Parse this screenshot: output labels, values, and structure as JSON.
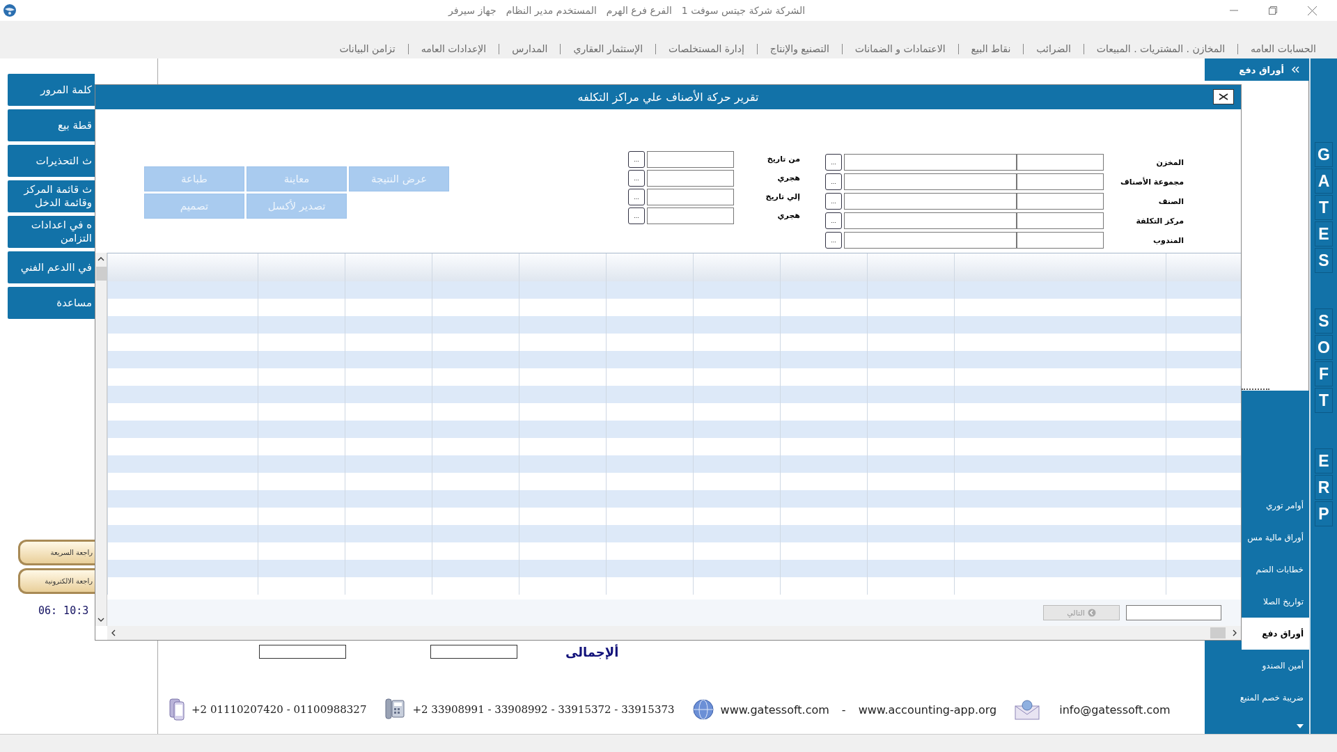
{
  "title_bar": {
    "segments": [
      "الشركة شركة جيتس سوفت 1",
      "الفرع فرع الهرم",
      "المستخدم مدير النظام",
      "جهاز سيرفر"
    ]
  },
  "menu": [
    "الحسابات العامه",
    "المخازن . المشتريات . المبيعات",
    "الضرائب",
    "نقاط البيع",
    "الاعتمادات و الضمانات",
    "التصنيع والإنتاج",
    "إدارة المستخلصات",
    "الإستثمار العقاري",
    "المدارس",
    "الإعدادات العامه",
    "تزامن البيانات"
  ],
  "left_sidebar": {
    "buttons": [
      "كلمة المرور",
      "قطة بيع",
      "ث التحذيرات",
      "ث قائمة المركز وقائمة الدخل",
      "ه في اعدادات التزامن",
      "في االدعم الفني",
      "مساعدة"
    ],
    "quick_buttons": [
      "راجعة السريعة",
      "راجعة الالكترونية"
    ],
    "clock": "06: 10:3"
  },
  "right_panel": {
    "header": "أوراق دفع",
    "items": [
      {
        "label": "أوامر توري",
        "selected": false
      },
      {
        "label": "أوراق مالية مس",
        "selected": false
      },
      {
        "label": "خطابات الضم",
        "selected": false
      },
      {
        "label": "تواريخ الصلا",
        "selected": false
      },
      {
        "label": "أوراق دفع",
        "selected": true
      },
      {
        "label": "أمين الصندو",
        "selected": false
      },
      {
        "label": "ضريبة خصم المنبع",
        "selected": false
      }
    ]
  },
  "brand_strip": {
    "words": [
      "GATES",
      "SOFT",
      "ERP"
    ]
  },
  "dialog": {
    "title": "تقرير حركة الأصناف علي مراكز التكلفه",
    "filter_fields": [
      {
        "label": "المخزن",
        "picker": "..."
      },
      {
        "label": "مجموعة الأصناف",
        "picker": "..."
      },
      {
        "label": "الصنف",
        "picker": "..."
      },
      {
        "label": "مركز التكلفة",
        "picker": "..."
      },
      {
        "label": "المندوب",
        "picker": "..."
      }
    ],
    "date_fields": [
      {
        "label": "من تاريخ",
        "picker": "..."
      },
      {
        "label": "هجري",
        "picker": "..."
      },
      {
        "label": "إلي تاريخ",
        "picker": "..."
      },
      {
        "label": "هجري",
        "picker": "..."
      }
    ],
    "action_rows": [
      [
        {
          "label": "عرض النتيجة",
          "disabled": true
        },
        {
          "label": "معاينة",
          "disabled": true
        },
        {
          "label": "طباعة",
          "disabled": true
        }
      ],
      [
        {
          "label": "تصدير لأكسل",
          "disabled": true
        },
        {
          "label": "تصميم",
          "disabled": true
        }
      ]
    ],
    "grid": {
      "next_button": {
        "label": "التالي",
        "disabled": true
      }
    }
  },
  "totals": {
    "label": "ألإجمالى"
  },
  "footer": {
    "mobile": "+2 01110207420 - 01100988327",
    "phone": "+2 33908991 - 33908992 - 33915372 - 33915373",
    "website": "www.gatessoft.com",
    "separator": "-",
    "website_2": "www.accounting-app.org",
    "email": "info@gatessoft.com"
  }
}
